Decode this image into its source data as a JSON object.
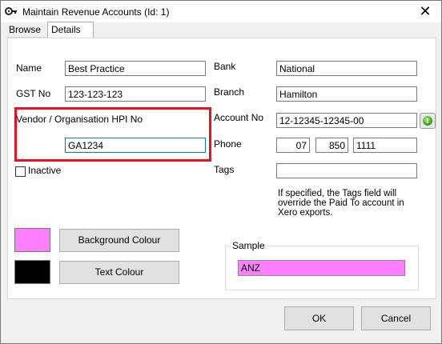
{
  "window": {
    "title": "Maintain Revenue Accounts (Id: 1)",
    "close_symbol": "✕"
  },
  "tabs": [
    {
      "label": "Browse"
    },
    {
      "label": "Details"
    }
  ],
  "form": {
    "name_label": "Name",
    "name_value": "Best Practice",
    "gst_label": "GST No",
    "gst_value": "123-123-123",
    "vendor_label": "Vendor / Organisation HPI No",
    "vendor_value": "GA1234",
    "inactive_label": "Inactive",
    "bank_label": "Bank",
    "bank_value": "National",
    "branch_label": "Branch",
    "branch_value": "Hamilton",
    "account_label": "Account No",
    "account_value": "12-12345-12345-00",
    "phone_label": "Phone",
    "phone_area": "07",
    "phone_prefix": "850",
    "phone_number": "1111",
    "tags_label": "Tags",
    "tags_value": "",
    "tags_help": "If specified, the Tags field will override the Paid To account in Xero exports."
  },
  "colours": {
    "background_swatch": "#ff80ff",
    "text_swatch": "#000000",
    "background_button": "Background Colour",
    "text_button": "Text Colour"
  },
  "sample": {
    "title": "Sample",
    "value": "ANZ",
    "bg": "#ff80ff",
    "fg": "#000000"
  },
  "buttons": {
    "ok": "OK",
    "cancel": "Cancel"
  },
  "icons": {
    "app": "gear-link-icon",
    "account_check": "green-info-icon",
    "close": "close-icon"
  }
}
